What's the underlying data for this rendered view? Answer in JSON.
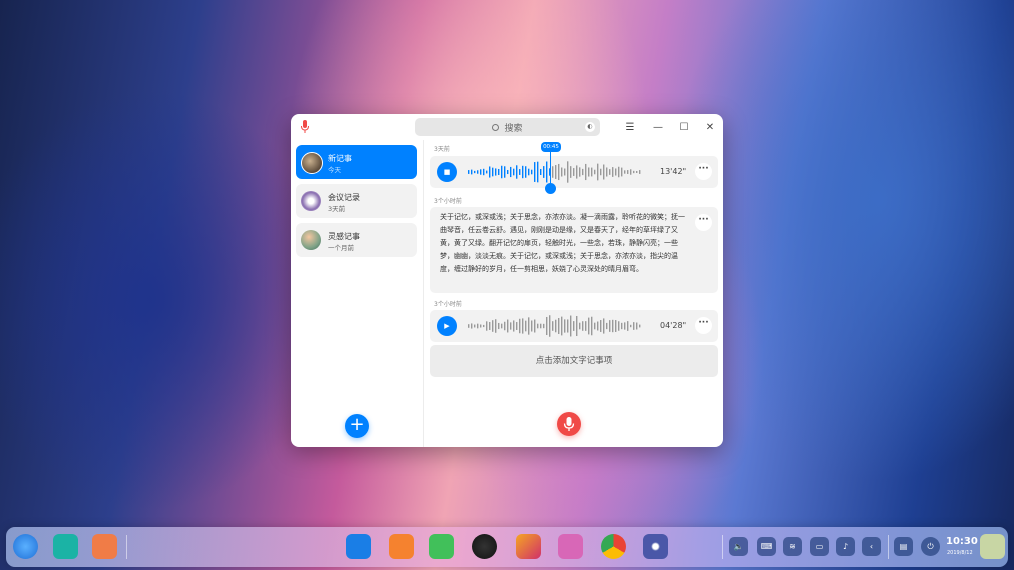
{
  "window": {
    "search_placeholder": "搜索",
    "controls": {
      "menu": "☰",
      "minimize": "—",
      "maximize": "☐",
      "close": "✕"
    }
  },
  "sidebar": {
    "items": [
      {
        "title": "新记事",
        "time": "今天",
        "active": true
      },
      {
        "title": "会议记录",
        "time": "3天前",
        "active": false
      },
      {
        "title": "灵感记事",
        "time": "一个月前",
        "active": false
      }
    ],
    "add_label": "+"
  },
  "main": {
    "entries": [
      {
        "label": "3天前",
        "type": "audio",
        "duration": "13'42\"",
        "playhead_time": "00:45",
        "state": "playing"
      },
      {
        "label": "3个小时前",
        "type": "text",
        "text": "关于记忆，或深或浅；关于思念，亦浓亦淡。凝一滴雨露，聆听花的微笑；抚一曲琴音，任云卷云舒。遇见，刚刚是动是缘，又是春天了，经年的草坪绿了又黄，黄了又绿。翻开记忆的扉页，轻触时光，一些念，若珠，静静闪亮；一些梦，幽幽，淡淡无痕。关于记忆，或深或浅；关于思念，亦浓亦淡，指尖的温度，缠过静好的岁月，任一剪相思，妖娆了心灵深处的晴月眉弯。"
      },
      {
        "label": "3个小时前",
        "type": "audio",
        "duration": "04'28\"",
        "state": "paused"
      }
    ],
    "add_text_label": "点击添加文字记事项"
  },
  "dock": {
    "clock": "10:30",
    "date": "2019/8/12"
  },
  "colors": {
    "accent": "#0081ff",
    "record": "#f04a47"
  }
}
